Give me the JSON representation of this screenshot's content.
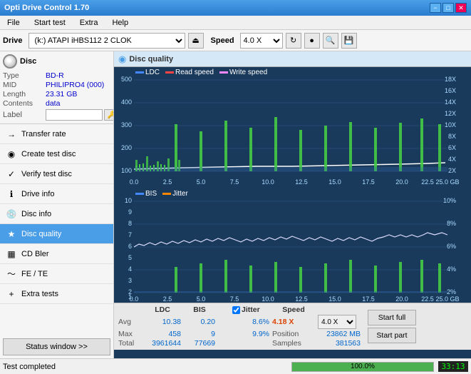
{
  "titlebar": {
    "title": "Opti Drive Control 1.70",
    "min": "−",
    "max": "□",
    "close": "✕"
  },
  "menubar": {
    "items": [
      "File",
      "Start test",
      "Extra",
      "Help"
    ]
  },
  "drive_toolbar": {
    "drive_label": "Drive",
    "drive_value": "(k:)  ATAPI iHBS112  2 CLOK",
    "speed_label": "Speed",
    "speed_value": "4.0 X"
  },
  "disc": {
    "header": "Disc",
    "type_label": "Type",
    "type_value": "BD-R",
    "mid_label": "MID",
    "mid_value": "PHILIPRO4 (000)",
    "length_label": "Length",
    "length_value": "23.31 GB",
    "contents_label": "Contents",
    "contents_value": "data",
    "label_label": "Label",
    "label_value": ""
  },
  "nav": {
    "items": [
      {
        "id": "transfer-rate",
        "label": "Transfer rate",
        "icon": "→"
      },
      {
        "id": "create-test-disc",
        "label": "Create test disc",
        "icon": "◉"
      },
      {
        "id": "verify-test-disc",
        "label": "Verify test disc",
        "icon": "✓"
      },
      {
        "id": "drive-info",
        "label": "Drive info",
        "icon": "ℹ"
      },
      {
        "id": "disc-info",
        "label": "Disc info",
        "icon": "💿"
      },
      {
        "id": "disc-quality",
        "label": "Disc quality",
        "icon": "★",
        "active": true
      },
      {
        "id": "cd-bler",
        "label": "CD Bler",
        "icon": "▦"
      },
      {
        "id": "fe-te",
        "label": "FE / TE",
        "icon": "~"
      },
      {
        "id": "extra-tests",
        "label": "Extra tests",
        "icon": "+"
      }
    ]
  },
  "disc_quality": {
    "title": "Disc quality",
    "legend": {
      "ldc": "LDC",
      "read_speed": "Read speed",
      "write_speed": "Write speed",
      "bis": "BIS",
      "jitter": "Jitter"
    }
  },
  "stats": {
    "col_headers": [
      "",
      "LDC",
      "BIS",
      "",
      "Jitter",
      "Speed",
      ""
    ],
    "rows": [
      {
        "label": "Avg",
        "ldc": "10.38",
        "bis": "0.20",
        "jitter": "8.6%",
        "speed": "4.18 X",
        "speed_set": "4.0 X"
      },
      {
        "label": "Max",
        "ldc": "458",
        "bis": "9",
        "jitter": "9.9%",
        "position_label": "Position",
        "position": "23862 MB"
      },
      {
        "label": "Total",
        "ldc": "3961644",
        "bis": "77669",
        "samples_label": "Samples",
        "samples": "381563"
      }
    ],
    "start_full": "Start full",
    "start_part": "Start part"
  },
  "bottom": {
    "status": "Test completed",
    "progress": 100,
    "progress_text": "100.0%",
    "time": "33:13"
  },
  "status_window": "Status window >>"
}
